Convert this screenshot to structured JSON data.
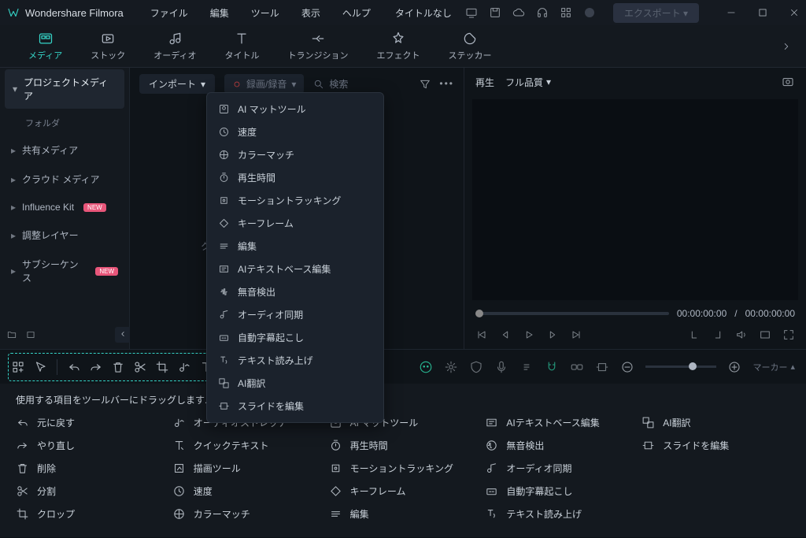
{
  "titlebar": {
    "app_name": "Wondershare Filmora",
    "menus": [
      "ファイル",
      "編集",
      "ツール",
      "表示",
      "ヘルプ"
    ],
    "project_title": "タイトルなし",
    "export_label": "エクスポート"
  },
  "tabs": [
    {
      "label": "メディア",
      "active": true
    },
    {
      "label": "ストック"
    },
    {
      "label": "オーディオ"
    },
    {
      "label": "タイトル"
    },
    {
      "label": "トランジション"
    },
    {
      "label": "エフェクト"
    },
    {
      "label": "ステッカー"
    }
  ],
  "sidebar": {
    "items": [
      {
        "label": "プロジェクトメディア",
        "selected": true
      },
      {
        "label": "フォルダ",
        "sub": true
      },
      {
        "label": "共有メディア"
      },
      {
        "label": "クラウド メディア"
      },
      {
        "label": "Influence Kit",
        "badge": "NEW"
      },
      {
        "label": "調整レイヤー"
      },
      {
        "label": "サブシーケンス",
        "badge": "NEW"
      }
    ]
  },
  "content": {
    "import_label": "インポート",
    "record_label": "録画/録音",
    "search_placeholder": "検索",
    "placeholder_text": "ク"
  },
  "context_menu": [
    "AI マットツール",
    "速度",
    "カラーマッチ",
    "再生時間",
    "モーショントラッキング",
    "キーフレーム",
    "編集",
    "AIテキストベース編集",
    "無音検出",
    "オーディオ同期",
    "自動字幕起こし",
    "テキスト読み上げ",
    "AI翻訳",
    "スライドを編集"
  ],
  "preview": {
    "play_label": "再生",
    "quality_label": "フル品質",
    "time_current": "00:00:00:00",
    "time_sep": "/",
    "time_total": "00:00:00:00"
  },
  "timeline": {
    "marker_label": "マーカー"
  },
  "palette": {
    "title": "使用する項目をツールバーにドラッグします...",
    "items": [
      "元に戻す",
      "オーディオストレッチ",
      "AI マットツール",
      "AIテキストベース編集",
      "AI翻訳",
      "やり直し",
      "クイックテキスト",
      "再生時間",
      "無音検出",
      "スライドを編集",
      "削除",
      "描画ツール",
      "モーショントラッキング",
      "オーディオ同期",
      "",
      "分割",
      "速度",
      "キーフレーム",
      "自動字幕起こし",
      "",
      "クロップ",
      "カラーマッチ",
      "編集",
      "テキスト読み上げ",
      ""
    ]
  }
}
